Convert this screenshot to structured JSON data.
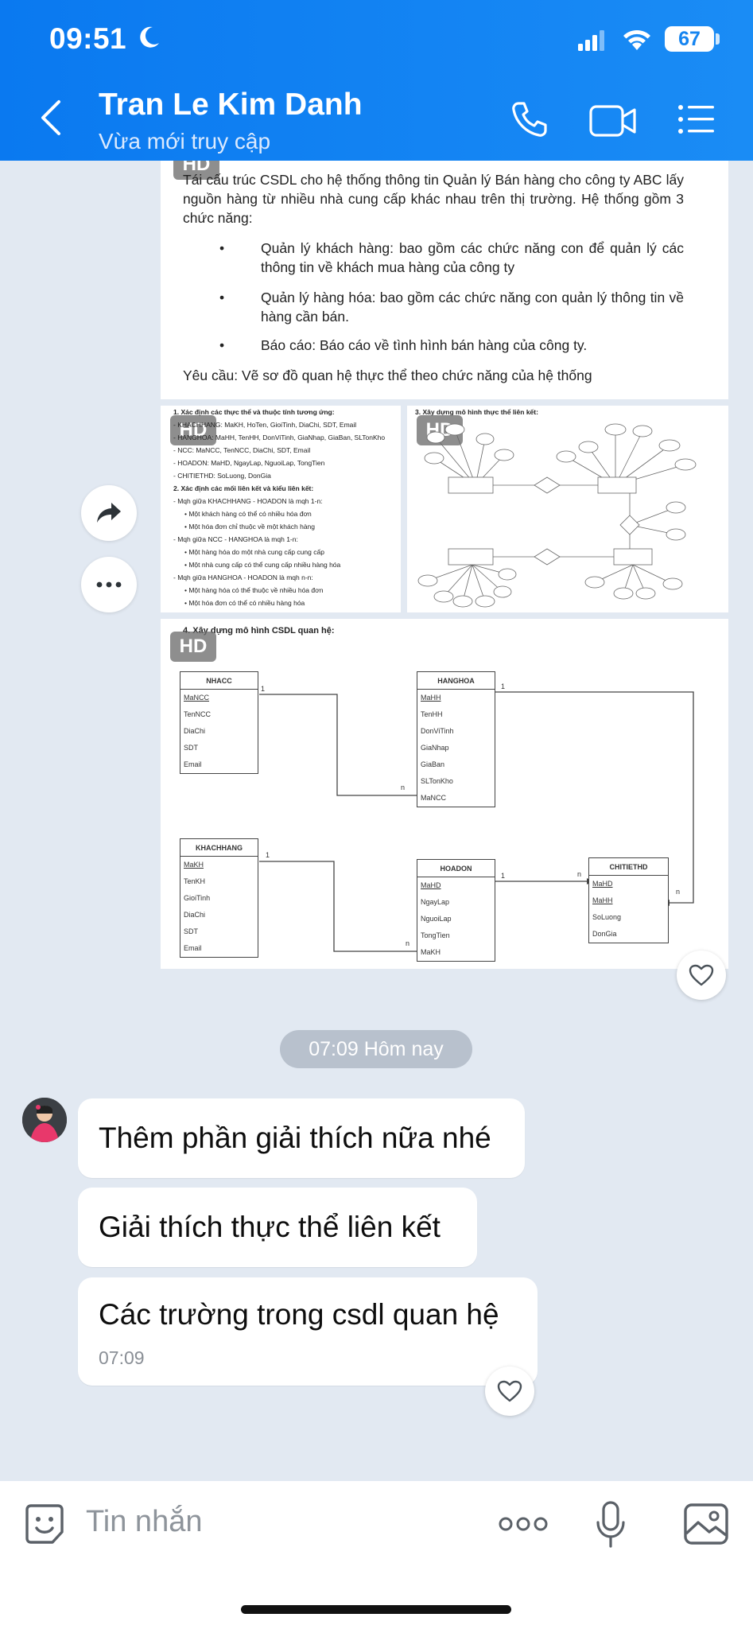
{
  "status_bar": {
    "time": "09:51",
    "battery": "67"
  },
  "header": {
    "contact_name": "Tran Le Kim Danh",
    "contact_status": "Vừa mới truy cập"
  },
  "doc_message": {
    "hd_label": "HD",
    "intro": "Tái cấu trúc CSDL cho hệ thống thông tin Quản lý Bán hàng cho công ty ABC lấy nguồn hàng từ nhiều nhà cung cấp khác nhau trên thị trường. Hệ thống gồm 3 chức năng:",
    "bullets": [
      "Quản lý khách hàng: bao gồm các chức năng con để quản lý các thông tin về khách mua hàng của công ty",
      "Quản lý hàng hóa: bao gồm các chức năng con quản lý thông tin về hàng cần bán.",
      "Báo cáo: Báo cáo về tình hình bán hàng của công ty."
    ],
    "requirement": "Yêu cầu: Vẽ sơ đồ quan hệ thực thể theo chức năng của hệ thống"
  },
  "entity_doc": {
    "heading1": "1. Xác định các thực thể và thuộc tính tương ứng:",
    "entities": [
      "- KHACHHANG: MaKH, HoTen, GioiTinh, DiaChi, SDT, Email",
      "- HANGHOA: MaHH, TenHH, DonViTinh, GiaNhap, GiaBan, SLTonKho",
      "- NCC: MaNCC, TenNCC, DiaChi, SDT, Email",
      "- HOADON: MaHD, NgayLap, NguoiLap, TongTien",
      "- CHITIETHD: SoLuong, DonGia"
    ],
    "heading2": "2. Xác định các mối liên kết và kiểu liên kết:",
    "links": [
      "- Mqh giữa KHACHHANG - HOADON là mqh 1-n:",
      "• Một khách hàng có thể có nhiều hóa đơn",
      "• Một hóa đơn chỉ thuộc về một khách hàng",
      "- Mqh giữa NCC - HANGHOA là mqh 1-n:",
      "• Một hàng hóa do một nhà cung cấp cung cấp",
      "• Một nhà cung cấp có thể cung cấp nhiều hàng hóa",
      "- Mqh giữa HANGHOA - HOADON là mqh n-n:",
      "• Một hàng hóa có thể thuộc về nhiều hóa đơn",
      "• Một hóa đơn có thể có nhiều hàng hóa"
    ],
    "heading3": "3. Xây dựng mô hình thực thể liên kết:"
  },
  "schema_doc": {
    "heading": "4. Xây dựng mô hình CSDL quan hệ:",
    "tables": {
      "nhacc": {
        "name": "NHACC",
        "fields": [
          "MaNCC",
          "TenNCC",
          "DiaChi",
          "SDT",
          "Email"
        ]
      },
      "hanghoa": {
        "name": "HANGHOA",
        "fields": [
          "MaHH",
          "TenHH",
          "DonViTinh",
          "GiaNhap",
          "GiaBan",
          "SLTonKho",
          "MaNCC"
        ]
      },
      "khachhang": {
        "name": "KHACHHANG",
        "fields": [
          "MaKH",
          "TenKH",
          "GioiTinh",
          "DiaChi",
          "SDT",
          "Email"
        ]
      },
      "hoadon": {
        "name": "HOADON",
        "fields": [
          "MaHD",
          "NgayLap",
          "NguoiLap",
          "TongTien",
          "MaKH"
        ]
      },
      "chitiethd": {
        "name": "CHITIETHD",
        "fields": [
          "MaHD",
          "MaHH",
          "SoLuong",
          "DonGia"
        ]
      }
    },
    "one": "1",
    "many": "n"
  },
  "chat": {
    "time_separator": "07:09 Hôm nay",
    "messages": [
      "Thêm phần giải thích nữa nhé",
      "Giải thích thực thể liên kết",
      "Các trường trong csdl quan hệ"
    ],
    "last_time": "07:09"
  },
  "composer": {
    "placeholder": "Tin nhắn"
  },
  "icons": {
    "back": "back-arrow-icon",
    "call": "phone-icon",
    "video": "video-camera-icon",
    "menu": "list-menu-icon",
    "forward": "forward-arrow-icon",
    "more": "more-dots-icon",
    "heart": "heart-icon",
    "sticker": "emoji-sticker-icon",
    "more_options": "more-options-icon",
    "mic": "microphone-icon",
    "image": "image-icon"
  },
  "colors": {
    "header": "#1584f0",
    "chat_bg": "#e2e9f2"
  }
}
